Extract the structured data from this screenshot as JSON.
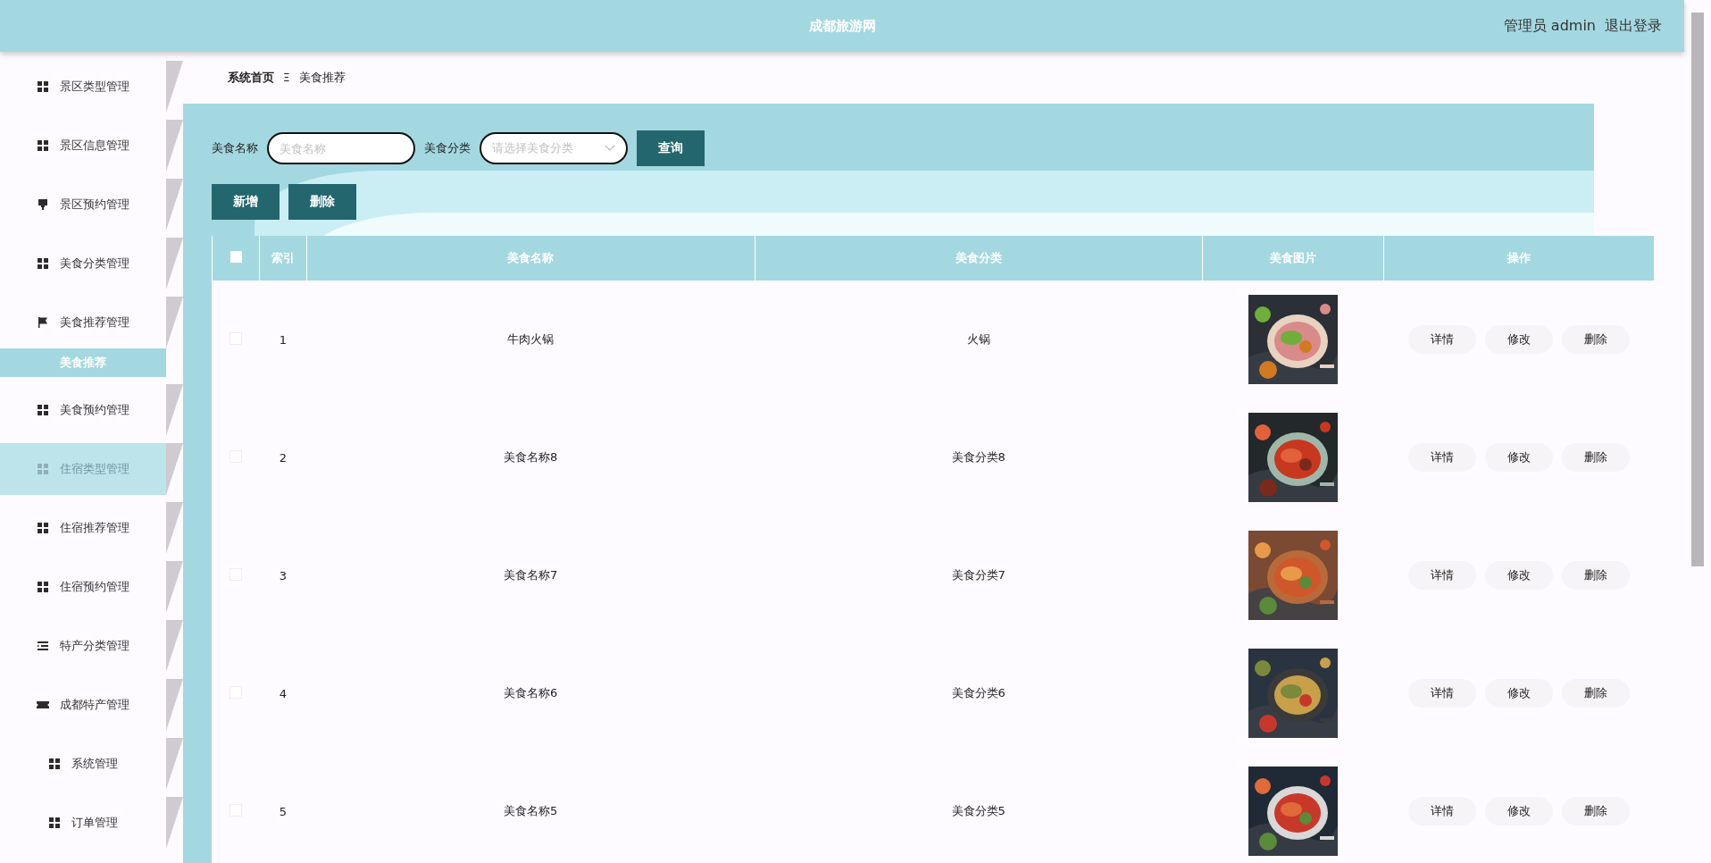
{
  "header": {
    "title": "成都旅游网",
    "user": "管理员 admin",
    "logout": "退出登录"
  },
  "sidebar": {
    "items": [
      {
        "label": "景区类型管理",
        "hovered": false
      },
      {
        "label": "景区信息管理",
        "hovered": false
      },
      {
        "label": "景区预约管理",
        "hovered": false
      },
      {
        "label": "美食分类管理",
        "hovered": false
      },
      {
        "label": "美食推荐管理",
        "hovered": false,
        "children": [
          {
            "label": "美食推荐",
            "selected": true
          }
        ]
      },
      {
        "label": "美食预约管理",
        "hovered": false
      },
      {
        "label": "住宿类型管理",
        "hovered": true
      },
      {
        "label": "住宿推荐管理",
        "hovered": false
      },
      {
        "label": "住宿预约管理",
        "hovered": false
      },
      {
        "label": "特产分类管理",
        "hovered": false
      },
      {
        "label": "成都特产管理",
        "hovered": false
      },
      {
        "label": "系统管理",
        "hovered": false
      },
      {
        "label": "订单管理",
        "hovered": false
      }
    ]
  },
  "breadcrumb": {
    "items": [
      "系统首页",
      "美食推荐"
    ],
    "separator": "Ξ"
  },
  "search": {
    "fields": [
      {
        "kind": "input",
        "label": "美食名称",
        "placeholder": "美食名称"
      },
      {
        "kind": "select",
        "label": "美食分类",
        "placeholder": "请选择美食分类"
      }
    ],
    "button": "查询"
  },
  "actions": [
    "新增",
    "删除"
  ],
  "table": {
    "header_checkbox": {
      "checked": false
    },
    "columns": [
      "索引",
      "美食名称",
      "美食分类",
      "美食图片",
      "操作"
    ],
    "rows": [
      {
        "checked": false,
        "index": "1",
        "name": "牛肉火锅",
        "category": "火锅",
        "buttons": [
          "详情",
          "修改",
          "删除"
        ]
      },
      {
        "checked": false,
        "index": "2",
        "name": "美食名称8",
        "category": "美食分类8",
        "buttons": [
          "详情",
          "修改",
          "删除"
        ]
      },
      {
        "checked": false,
        "index": "3",
        "name": "美食名称7",
        "category": "美食分类7",
        "buttons": [
          "详情",
          "修改",
          "删除"
        ]
      },
      {
        "checked": false,
        "index": "4",
        "name": "美食名称6",
        "category": "美食分类6",
        "buttons": [
          "详情",
          "修改",
          "删除"
        ]
      },
      {
        "checked": false,
        "index": "5",
        "name": "美食名称5",
        "category": "美食分类5",
        "buttons": [
          "详情",
          "修改",
          "删除"
        ]
      }
    ]
  }
}
